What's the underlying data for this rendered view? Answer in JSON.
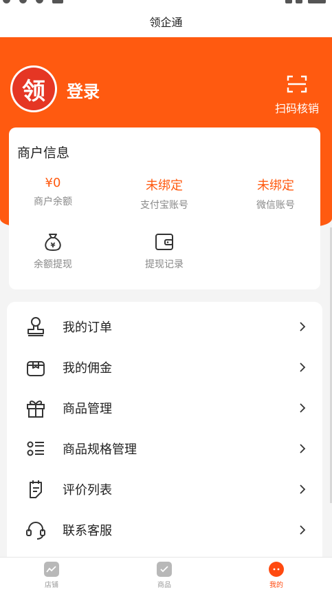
{
  "app": {
    "title": "领企通"
  },
  "header": {
    "logo_char": "领",
    "login_label": "登录",
    "scan_label": "扫码核销"
  },
  "merchant": {
    "title": "商户信息",
    "stats": [
      {
        "value": "¥0",
        "label": "商户余额"
      },
      {
        "value": "未绑定",
        "label": "支付宝账号"
      },
      {
        "value": "未绑定",
        "label": "微信账号"
      }
    ],
    "actions": [
      {
        "label": "余额提现",
        "icon": "money-bag-icon"
      },
      {
        "label": "提现记录",
        "icon": "wallet-icon"
      }
    ]
  },
  "menu": {
    "items": [
      {
        "label": "我的订单",
        "icon": "stamp-icon"
      },
      {
        "label": "我的佣金",
        "icon": "box-icon"
      },
      {
        "label": "商品管理",
        "icon": "gift-icon"
      },
      {
        "label": "商品规格管理",
        "icon": "list-icon"
      },
      {
        "label": "评价列表",
        "icon": "clipboard-icon"
      },
      {
        "label": "联系客服",
        "icon": "headset-icon"
      }
    ]
  },
  "tabbar": {
    "tabs": [
      {
        "label": "店铺",
        "icon": "chart-icon",
        "active": false
      },
      {
        "label": "商品",
        "icon": "document-icon",
        "active": false
      },
      {
        "label": "我的",
        "icon": "profile-icon",
        "active": true
      }
    ]
  },
  "colors": {
    "accent": "#ff5a10",
    "logo": "#e53624"
  }
}
